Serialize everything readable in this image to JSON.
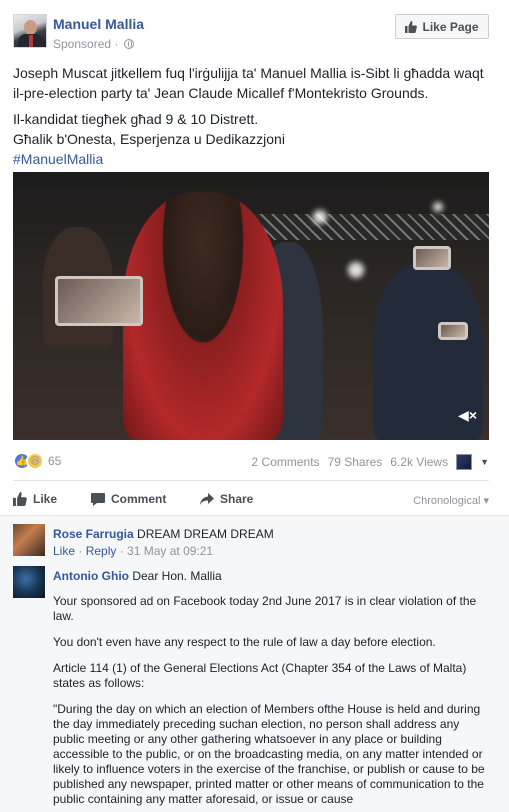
{
  "post": {
    "page_name": "Manuel Mallia",
    "sponsored": "Sponsored · ",
    "like_page_label": "Like Page",
    "text_line1": "Joseph Muscat jitkellem fuq l'irġulijja ta' Manuel Mallia is-Sibt li għadda waqt il-pre-election party ta' Jean Claude Micallef f'Montekristo Grounds.",
    "text_line2a": "Il-kandidat tiegħek għad 9 & 10 Distrett.",
    "text_line2b": "Għalik b'Onesta, Esperjenza u Dedikazzjoni",
    "hashtag": "#ManuelMallia"
  },
  "video": {
    "mute_icon": "speaker-muted-icon",
    "mute_glyph": "◀×"
  },
  "stats": {
    "reaction_count": "65",
    "comments": "2 Comments",
    "shares": "79 Shares",
    "views": "6.2k Views"
  },
  "actions": {
    "like": "Like",
    "comment": "Comment",
    "share": "Share",
    "sort": "Chronological ▾"
  },
  "comments": [
    {
      "author": "Rose Farrugia",
      "text": " DREAM DREAM DREAM",
      "like": "Like",
      "reply": "Reply",
      "time": " · 31 May at 09:21"
    },
    {
      "author": "Antonio Ghio",
      "text": " Dear Hon. Mallia",
      "para1": "Your sponsored ad on Facebook today 2nd June 2017 is in clear violation of the law.",
      "para2": "You don't even have any respect to the rule of law a day before election.",
      "para3": "Article 114 (1) of the General Elections Act (Chapter 354 of the Laws of Malta) states as follows:",
      "para4": "\"During the day on which an election of Members ofthe House is held and during the day immediately preceding suchan election, no person shall address any public meeting or any other gathering whatsoever in any place or building accessible to the public, or on the broadcasting media, on any matter intended or likely to influence voters in the exercise of the franchise, or publish or cause to be published any newspaper, printed matter or other means of communication to the public containing any matter aforesaid, or issue or cause"
    }
  ],
  "colors": {
    "link": "#365899",
    "meta": "#90949c",
    "text": "#1d2129"
  }
}
